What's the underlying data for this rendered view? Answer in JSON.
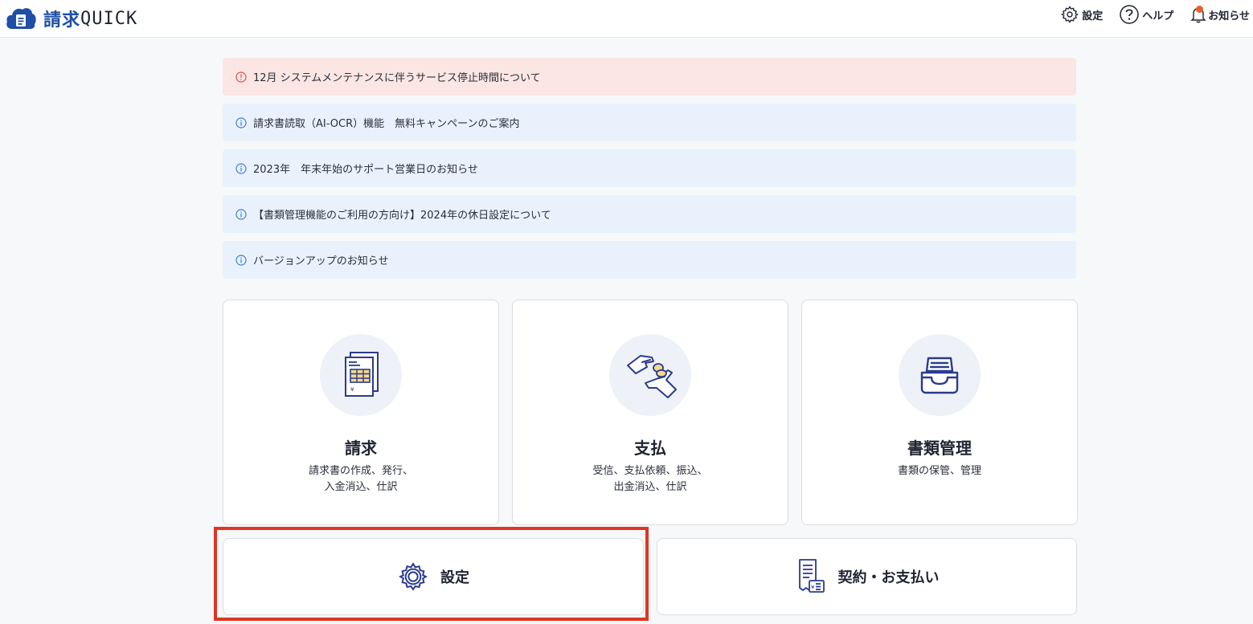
{
  "header": {
    "brand_jp": "請求",
    "brand_en": "QUICK",
    "nav": {
      "settings": "設定",
      "help": "ヘルプ",
      "notifications": "お知らせ"
    }
  },
  "notices": [
    {
      "type": "alert",
      "text": "12月 システムメンテナンスに伴うサービス停止時間について"
    },
    {
      "type": "info",
      "text": "請求書読取（AI-OCR）機能　無料キャンペーンのご案内"
    },
    {
      "type": "info",
      "text": "2023年　年末年始のサポート営業日のお知らせ"
    },
    {
      "type": "info",
      "text": "【書類管理機能のご利用の方向け】2024年の休日設定について"
    },
    {
      "type": "info",
      "text": "バージョンアップのお知らせ"
    }
  ],
  "cards": [
    {
      "title": "請求",
      "desc_line1": "請求書の作成、発行、",
      "desc_line2": "入金消込、仕訳",
      "icon": "invoice-document-icon"
    },
    {
      "title": "支払",
      "desc_line1": "受信、支払依頼、振込、",
      "desc_line2": "出金消込、仕訳",
      "icon": "coin-hand-icon"
    },
    {
      "title": "書類管理",
      "desc_line1": "書類の保管、管理",
      "desc_line2": "",
      "icon": "document-tray-icon"
    }
  ],
  "bottom": {
    "settings_label": "設定",
    "contract_label": "契約・お支払い"
  },
  "colors": {
    "brand": "#1f4fa6",
    "alert_bg": "#fbe6e4",
    "info_bg": "#e9f2fc",
    "highlight": "#e03524",
    "notification_dot": "#e8612c"
  }
}
